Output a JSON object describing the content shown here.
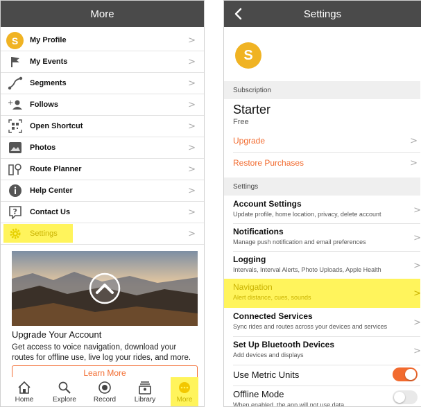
{
  "colors": {
    "nav_bar": "#4a4a4a",
    "accent_orange": "#f26b2f",
    "highlight_yellow": "#fff45c",
    "avatar_yellow": "#f0b323"
  },
  "more_screen": {
    "title": "More",
    "avatar_letter": "S",
    "menu": [
      {
        "label": "My Profile",
        "icon": "avatar-icon"
      },
      {
        "label": "My Events",
        "icon": "flag-icon"
      },
      {
        "label": "Segments",
        "icon": "segments-icon"
      },
      {
        "label": "Follows",
        "icon": "add-person-icon"
      },
      {
        "label": "Open Shortcut",
        "icon": "qr-scan-icon"
      },
      {
        "label": "Photos",
        "icon": "photo-icon"
      },
      {
        "label": "Route Planner",
        "icon": "route-planner-icon"
      },
      {
        "label": "Help Center",
        "icon": "info-icon"
      },
      {
        "label": "Contact Us",
        "icon": "question-icon"
      },
      {
        "label": "Settings",
        "icon": "gear-icon",
        "highlighted": true
      }
    ],
    "promo": {
      "title": "Upgrade Your Account",
      "body": "Get access to voice navigation, download your routes for offline use, live log your rides, and more.",
      "button": "Learn More"
    },
    "tabs": [
      {
        "label": "Home",
        "icon": "home-icon"
      },
      {
        "label": "Explore",
        "icon": "search-icon"
      },
      {
        "label": "Record",
        "icon": "record-icon"
      },
      {
        "label": "Library",
        "icon": "library-icon"
      },
      {
        "label": "More",
        "icon": "more-icon",
        "highlighted": true
      }
    ]
  },
  "settings_screen": {
    "title": "Settings",
    "avatar_letter": "S",
    "subscription_header": "Subscription",
    "plan_name": "Starter",
    "plan_price": "Free",
    "upgrade_label": "Upgrade",
    "restore_label": "Restore Purchases",
    "settings_header": "Settings",
    "items": [
      {
        "title": "Account Settings",
        "subtitle": "Update profile, home location, privacy, delete account"
      },
      {
        "title": "Notifications",
        "subtitle": "Manage push notification and email preferences"
      },
      {
        "title": "Logging",
        "subtitle": "Intervals, Interval Alerts, Photo Uploads, Apple Health"
      },
      {
        "title": "Navigation",
        "subtitle": "Alert distance, cues, sounds",
        "highlighted": true
      },
      {
        "title": "Connected Services",
        "subtitle": "Sync rides and routes across your devices and services"
      },
      {
        "title": "Set Up Bluetooth Devices",
        "subtitle": "Add devices and displays"
      }
    ],
    "metric_units": {
      "label": "Use Metric Units",
      "on": true
    },
    "offline_mode": {
      "label": "Offline Mode",
      "subtitle": "When enabled, the app will not use data",
      "on": false
    }
  }
}
